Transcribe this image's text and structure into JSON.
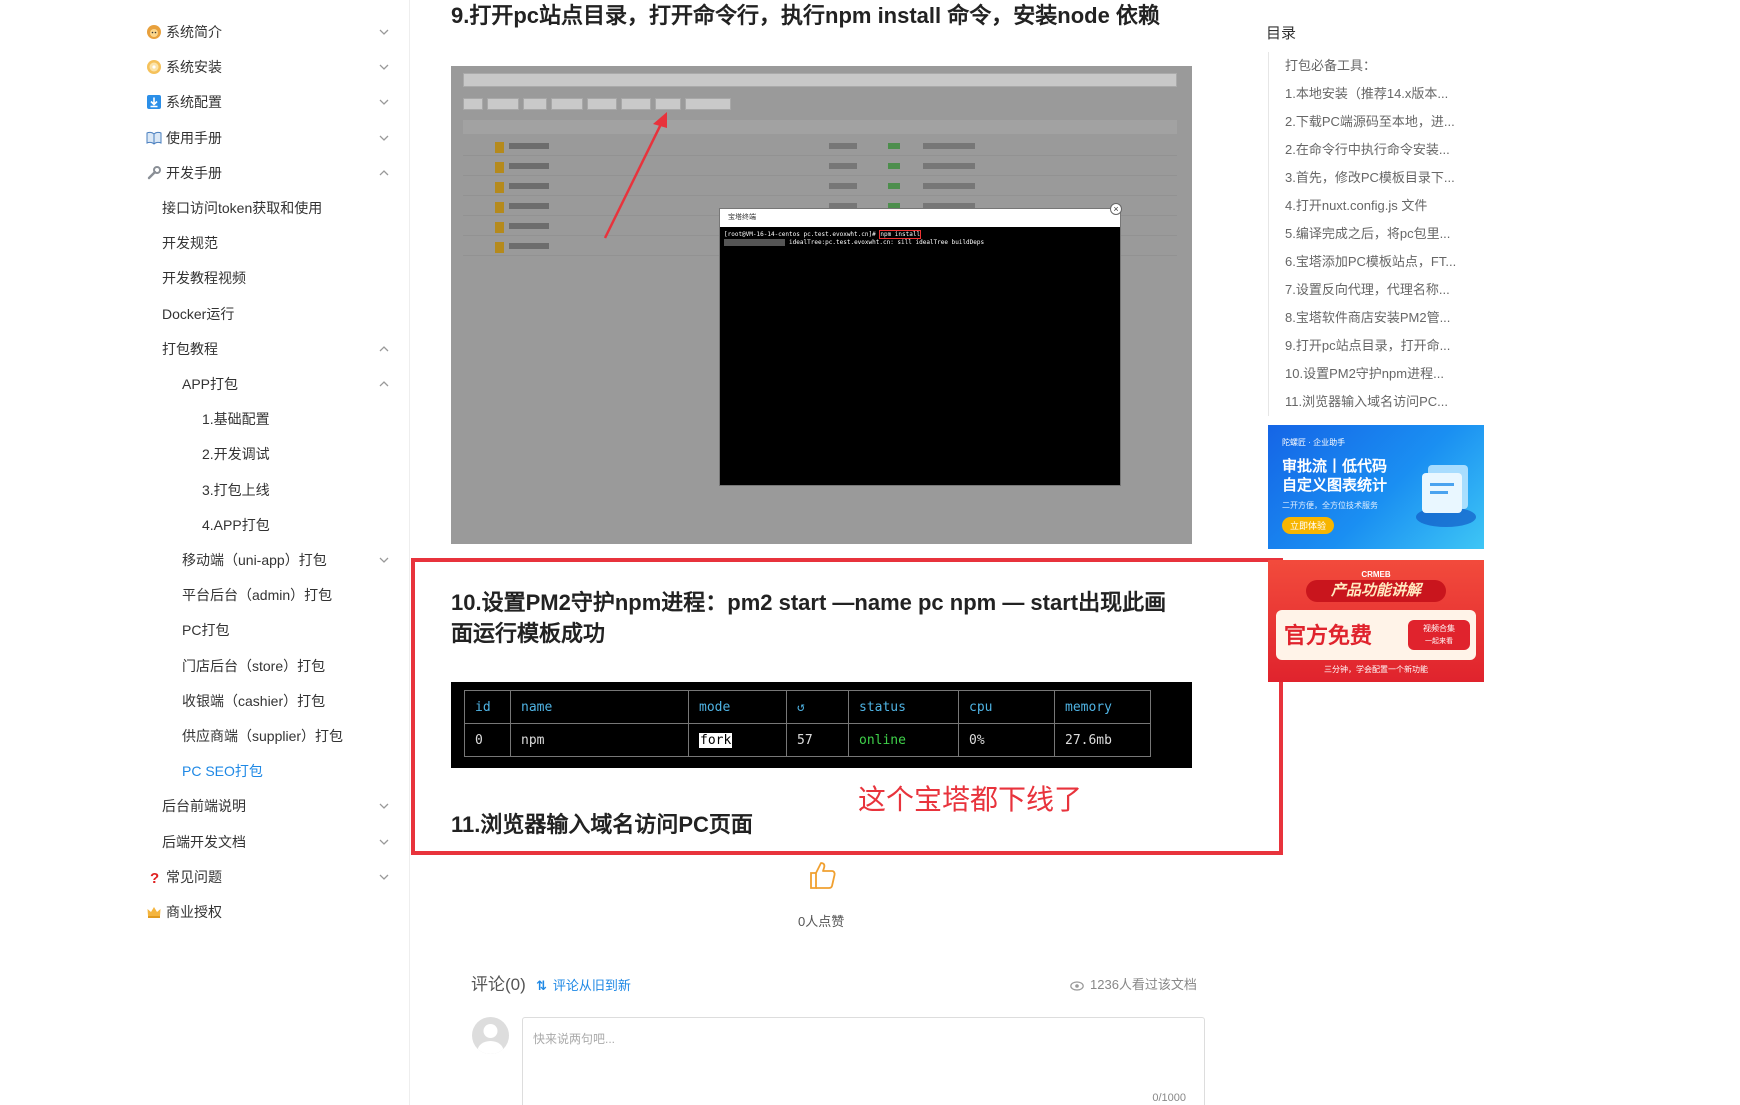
{
  "sidebar": {
    "items": [
      {
        "label": "系统简介",
        "icon": "lion-icon",
        "level": 0,
        "chevron": "down"
      },
      {
        "label": "系统安装",
        "icon": "disc-icon",
        "level": 0,
        "chevron": "down"
      },
      {
        "label": "系统配置",
        "icon": "download-icon",
        "level": 0,
        "chevron": "down"
      },
      {
        "label": "使用手册",
        "icon": "book-icon",
        "level": 0,
        "chevron": "down"
      },
      {
        "label": "开发手册",
        "icon": "wrench-icon",
        "level": 0,
        "chevron": "up"
      },
      {
        "label": "接口访问token获取和使用",
        "level": 1
      },
      {
        "label": "开发规范",
        "level": 1
      },
      {
        "label": "开发教程视频",
        "level": 1
      },
      {
        "label": "Docker运行",
        "level": 1
      },
      {
        "label": "打包教程",
        "level": 1,
        "chevron": "up"
      },
      {
        "label": "APP打包",
        "level": 2,
        "chevron": "up"
      },
      {
        "label": "1.基础配置",
        "level": 3
      },
      {
        "label": "2.开发调试",
        "level": 3
      },
      {
        "label": "3.打包上线",
        "level": 3
      },
      {
        "label": "4.APP打包",
        "level": 3
      },
      {
        "label": "移动端（uni-app）打包",
        "level": 2,
        "chevron": "down"
      },
      {
        "label": "平台后台（admin）打包",
        "level": 2
      },
      {
        "label": "PC打包",
        "level": 2
      },
      {
        "label": "门店后台（store）打包",
        "level": 2
      },
      {
        "label": "收银端（cashier）打包",
        "level": 2
      },
      {
        "label": "供应商端（supplier）打包",
        "level": 2
      },
      {
        "label": "PC SEO打包",
        "level": 2,
        "active": true
      },
      {
        "label": "后台前端说明",
        "level": 1,
        "chevron": "down"
      },
      {
        "label": "后端开发文档",
        "level": 1,
        "chevron": "down"
      },
      {
        "label": "常见问题",
        "icon": "question-icon",
        "level": 0,
        "chevron": "down"
      },
      {
        "label": "商业授权",
        "icon": "crown-icon",
        "level": 0
      }
    ],
    "active_color": "#1e88e5"
  },
  "main": {
    "step9_title": "9.打开pc站点目录，打开命令行，执行npm install 命令，安装node 依赖",
    "terminal": {
      "window_title": "宝塔终端",
      "prompt": "[root@VM-16-14-centos pc.test.evoxwht.cn]#",
      "command": "npm install",
      "progress_line": "idealTree:pc.test.evoxwht.cn: sill idealTree buildDeps"
    },
    "step10_title": "10.设置PM2守护npm进程：pm2 start —name pc npm — start出现此画面运行模板成功",
    "pm2_table": {
      "headers": [
        "id",
        "name",
        "mode",
        "↺",
        "status",
        "cpu",
        "memory"
      ],
      "row": [
        "0",
        "npm",
        "fork",
        "57",
        "online",
        "0%",
        "27.6mb"
      ]
    },
    "annotation": "这个宝塔都下线了",
    "step11_title": "11.浏览器输入域名访问PC页面",
    "likes": "0人点赞",
    "comments": {
      "title": "评论(0)",
      "sort_label": "评论从旧到新",
      "views": "1236人看过该文档",
      "placeholder": "快来说两句吧...",
      "counter": "0/1000"
    },
    "annotation_color": "#e8333c"
  },
  "toc": {
    "title": "目录",
    "items": [
      "打包必备工具：",
      "1.本地安装（推荐14.x版本...",
      "2.下载PC端源码至本地，进...",
      "2.在命令行中执行命令安装...",
      "3.首先，修改PC模板目录下...",
      "4.打开nuxt.config.js 文件",
      "5.编译完成之后，将pc包里...",
      "6.宝塔添加PC模板站点，FT...",
      "7.设置反向代理，代理名称...",
      "8.宝塔软件商店安装PM2管...",
      "9.打开pc站点目录，打开命...",
      "10.设置PM2守护npm进程...",
      "11.浏览器输入域名访问PC..."
    ]
  },
  "ads": {
    "ad1": {
      "brand": "陀螺匠 · 企业助手",
      "title_line1": "审批流丨低代码",
      "title_line2": "自定义图表统计",
      "subtitle": "二开方便，全方位技术服务",
      "button": "立即体验"
    },
    "ad2": {
      "brand": "CRMEB",
      "title": "产品功能讲解",
      "headline": "官方免费",
      "tag_top": "视频合集",
      "tag_bottom": "一起来看",
      "subtitle": "三分钟，学会配置一个新功能"
    }
  }
}
